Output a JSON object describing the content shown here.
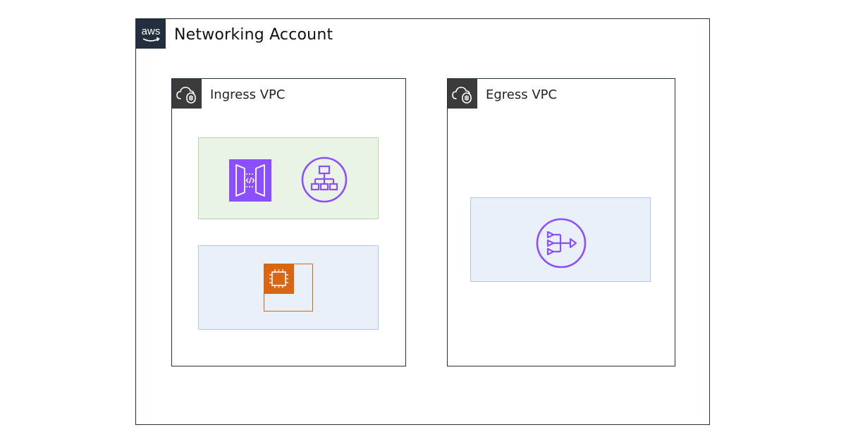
{
  "account": {
    "logo_text": "aws",
    "title": "Networking Account"
  },
  "ingress_vpc": {
    "title": "Ingress VPC",
    "public_subnet": {
      "icons": [
        "api-gateway-icon",
        "load-balancer-icon"
      ]
    },
    "private_subnet": {
      "icons": [
        "ec2-instance-icon"
      ]
    }
  },
  "egress_vpc": {
    "title": "Egress VPC",
    "private_subnet": {
      "icons": [
        "nat-gateway-icon"
      ]
    }
  },
  "colors": {
    "border": "#232f3e",
    "public_subnet_fill": "#e9f3e6",
    "public_subnet_border": "#b4d8a6",
    "private_subnet_fill": "#e9f0fa",
    "private_subnet_border": "#b3c6e4",
    "networking_purple": "#8c4fff",
    "compute_orange": "#d86613"
  }
}
